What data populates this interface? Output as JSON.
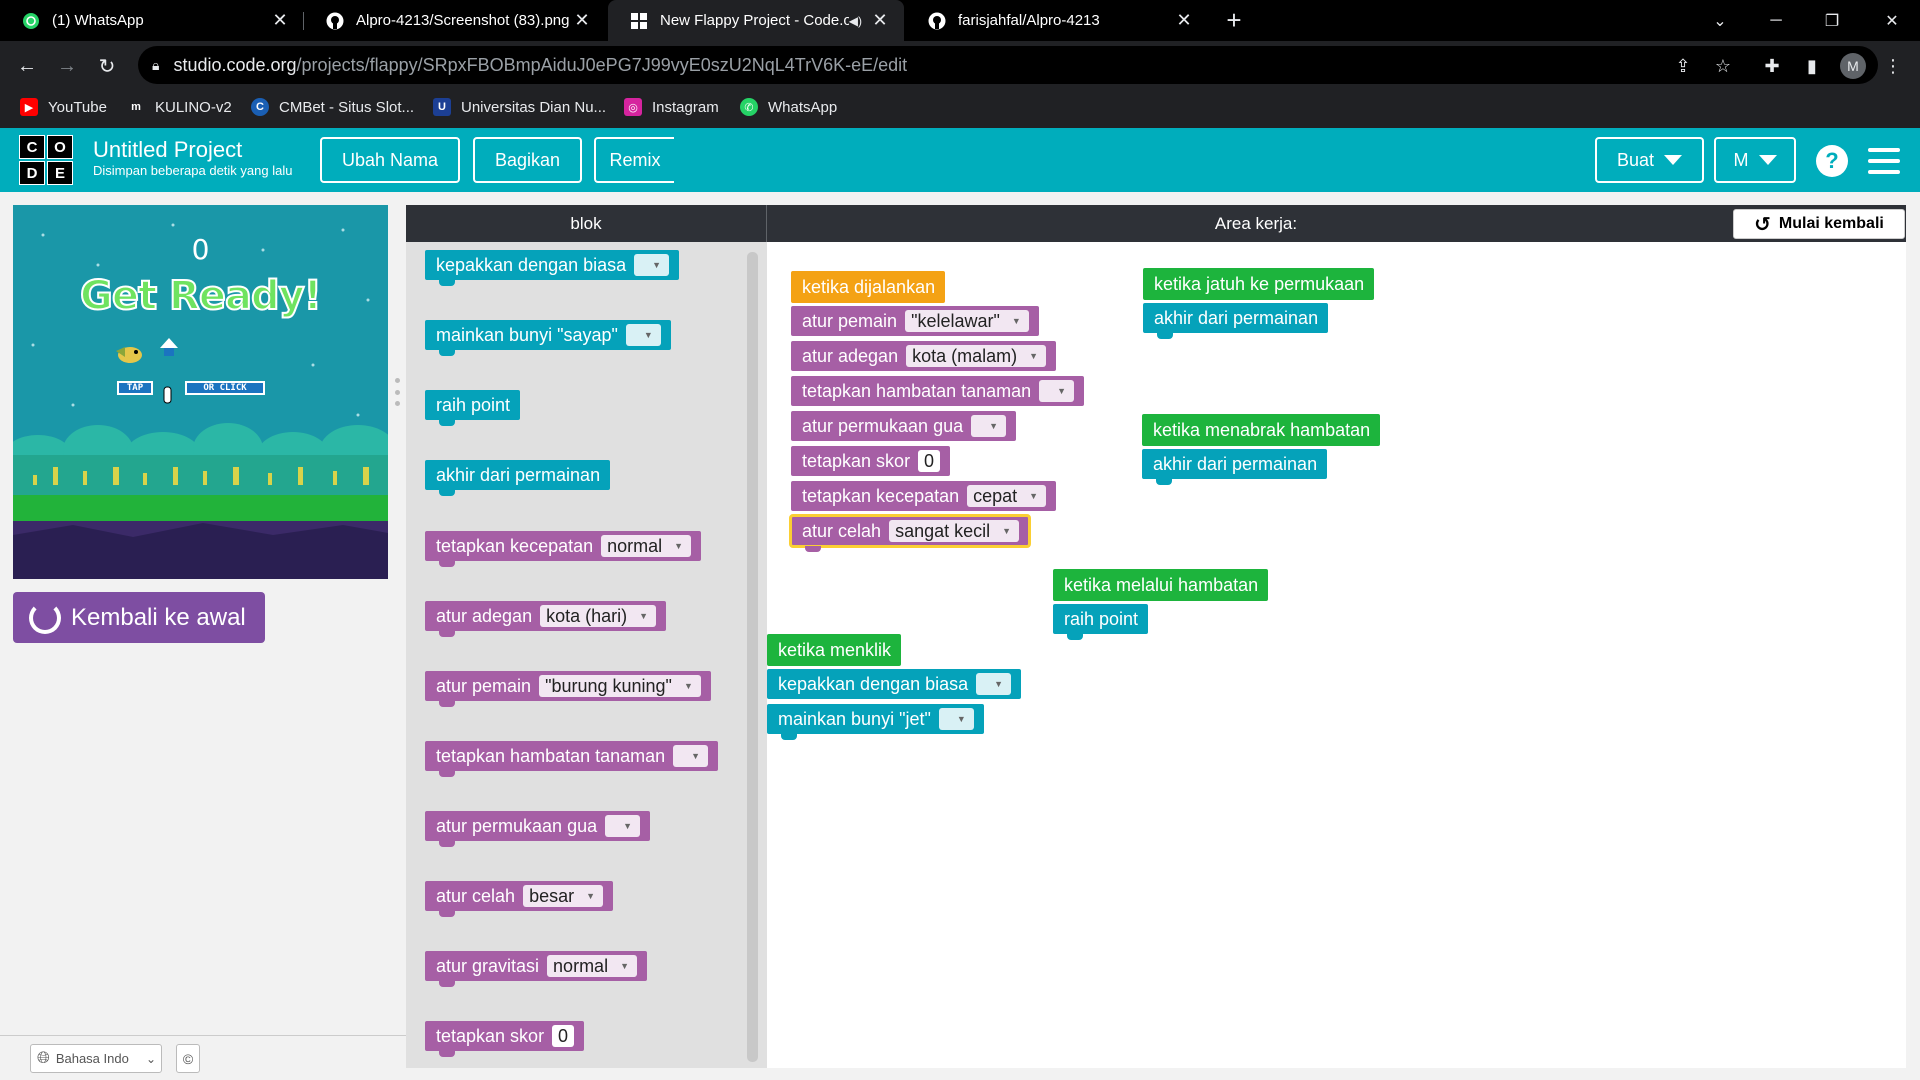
{
  "browser": {
    "tabs": [
      {
        "title": "(1) WhatsApp",
        "icon": "whatsapp-icon"
      },
      {
        "title": "Alpro-4213/Screenshot (83).png",
        "icon": "github-icon"
      },
      {
        "title": "New Flappy Project - Code.o",
        "icon": "codeorg-icon"
      },
      {
        "title": "farisjahfal/Alpro-4213",
        "icon": "github-icon"
      }
    ],
    "new_tab_label": "+",
    "url_domain": "studio.code.org",
    "url_path": "/projects/flappy/SRpxFBOBmpAiduJ0ePG7J99vyE0szU2NqL4TrV6K-eE/edit",
    "profile_initial": "M",
    "bookmarks": [
      {
        "label": "YouTube",
        "color": "#ff0000"
      },
      {
        "label": "KULINO-v2",
        "color": "#202124"
      },
      {
        "label": "CMBet - Situs Slot...",
        "color": "#1a5fb4"
      },
      {
        "label": "Universitas Dian Nu...",
        "color": "#1c3f94"
      },
      {
        "label": "Instagram",
        "color": "#d6249f"
      },
      {
        "label": "WhatsApp",
        "color": "#25d366"
      }
    ]
  },
  "header": {
    "logo_letters": [
      "C",
      "O",
      "D",
      "E"
    ],
    "project_title": "Untitled Project",
    "saved_status": "Disimpan beberapa detik yang lalu",
    "rename_label": "Ubah Nama",
    "share_label": "Bagikan",
    "remix_label": "Remix",
    "create_label": "Buat",
    "user_label": "M",
    "help_label": "?",
    "accent_color": "#00adbc"
  },
  "game": {
    "score": "0",
    "get_ready": "Get Ready!",
    "tap_label": "TAP",
    "click_label": "OR CLICK"
  },
  "reset_label": "Kembali ke awal",
  "footer": {
    "language": "Bahasa Indo",
    "copyright": "©"
  },
  "workspace_header": {
    "toolbox_title": "blok",
    "workspace_title": "Area kerja:",
    "start_over_label": "Mulai kembali"
  },
  "toolbox": [
    {
      "color": "cyan",
      "text": "kepakkan dengan biasa",
      "dropdown": ""
    },
    {
      "color": "cyan",
      "text": "mainkan bunyi \"sayap\"",
      "dropdown": ""
    },
    {
      "color": "cyan",
      "text": "raih point"
    },
    {
      "color": "cyan",
      "text": "akhir dari permainan"
    },
    {
      "color": "purple",
      "text": "tetapkan kecepatan",
      "dropdown": "normal"
    },
    {
      "color": "purple",
      "text": "atur adegan",
      "dropdown": "kota (hari)"
    },
    {
      "color": "purple",
      "text": "atur pemain",
      "dropdown": "\"burung kuning\""
    },
    {
      "color": "purple",
      "text": "tetapkan hambatan tanaman",
      "dropdown": ""
    },
    {
      "color": "purple",
      "text": "atur permukaan gua",
      "dropdown": ""
    },
    {
      "color": "purple",
      "text": "atur celah",
      "dropdown": "besar"
    },
    {
      "color": "purple",
      "text": "atur gravitasi",
      "dropdown": "normal"
    },
    {
      "color": "purple",
      "text": "tetapkan skor",
      "number": "0"
    }
  ],
  "workspace": {
    "when_run": {
      "event": "ketika dijalankan",
      "blocks": [
        {
          "text": "atur pemain",
          "dropdown": "\"kelelawar\""
        },
        {
          "text": "atur adegan",
          "dropdown": "kota (malam)"
        },
        {
          "text": "tetapkan hambatan tanaman",
          "dropdown": ""
        },
        {
          "text": "atur permukaan gua",
          "dropdown": ""
        },
        {
          "text": "tetapkan skor",
          "number": "0"
        },
        {
          "text": "tetapkan kecepatan",
          "dropdown": "cepat"
        },
        {
          "text": "atur celah",
          "dropdown": "sangat kecil"
        }
      ]
    },
    "when_ground": {
      "event": "ketika jatuh ke permukaan",
      "action": "akhir dari permainan"
    },
    "when_obstacle": {
      "event": "ketika menabrak hambatan",
      "action": "akhir dari permainan"
    },
    "when_pass": {
      "event": "ketika melalui hambatan",
      "action": "raih point"
    },
    "when_click": {
      "event": "ketika menklik",
      "actions": [
        {
          "text": "kepakkan dengan biasa",
          "dropdown": ""
        },
        {
          "text": "mainkan bunyi \"jet\"",
          "dropdown": ""
        }
      ]
    }
  }
}
